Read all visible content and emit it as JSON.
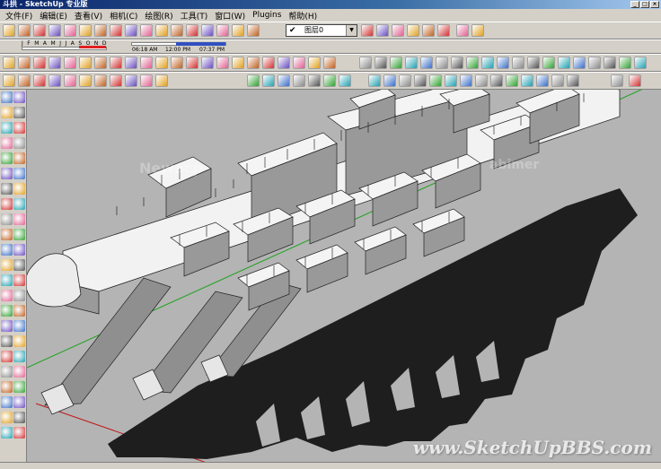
{
  "window": {
    "title": "斗拱 - SketchUp 专业版"
  },
  "menu": {
    "items": [
      "文件(F)",
      "编辑(E)",
      "查看(V)",
      "相机(C)",
      "绘图(R)",
      "工具(T)",
      "窗口(W)",
      "Plugins",
      "帮助(H)"
    ]
  },
  "shadow": {
    "months": "J F M A M J J A S O N D",
    "time_start": "06:18 AM",
    "time_mid": "12:00 PM",
    "time_end": "07:37 PM"
  },
  "layer": {
    "current": "图层0"
  },
  "watermarks": {
    "site": "www.SketchUpBBS.com",
    "faint_left": "Newacp",
    "faint_right": "abimer"
  },
  "colors": {
    "sky": "#b4b4b4",
    "ground": "#b4b4b4",
    "model_face": "#f2f2f2",
    "model_side": "#9a9a9a",
    "shadow": "#1e1e1e",
    "axis_green": "#1fa11f",
    "axis_red": "#c01818"
  }
}
